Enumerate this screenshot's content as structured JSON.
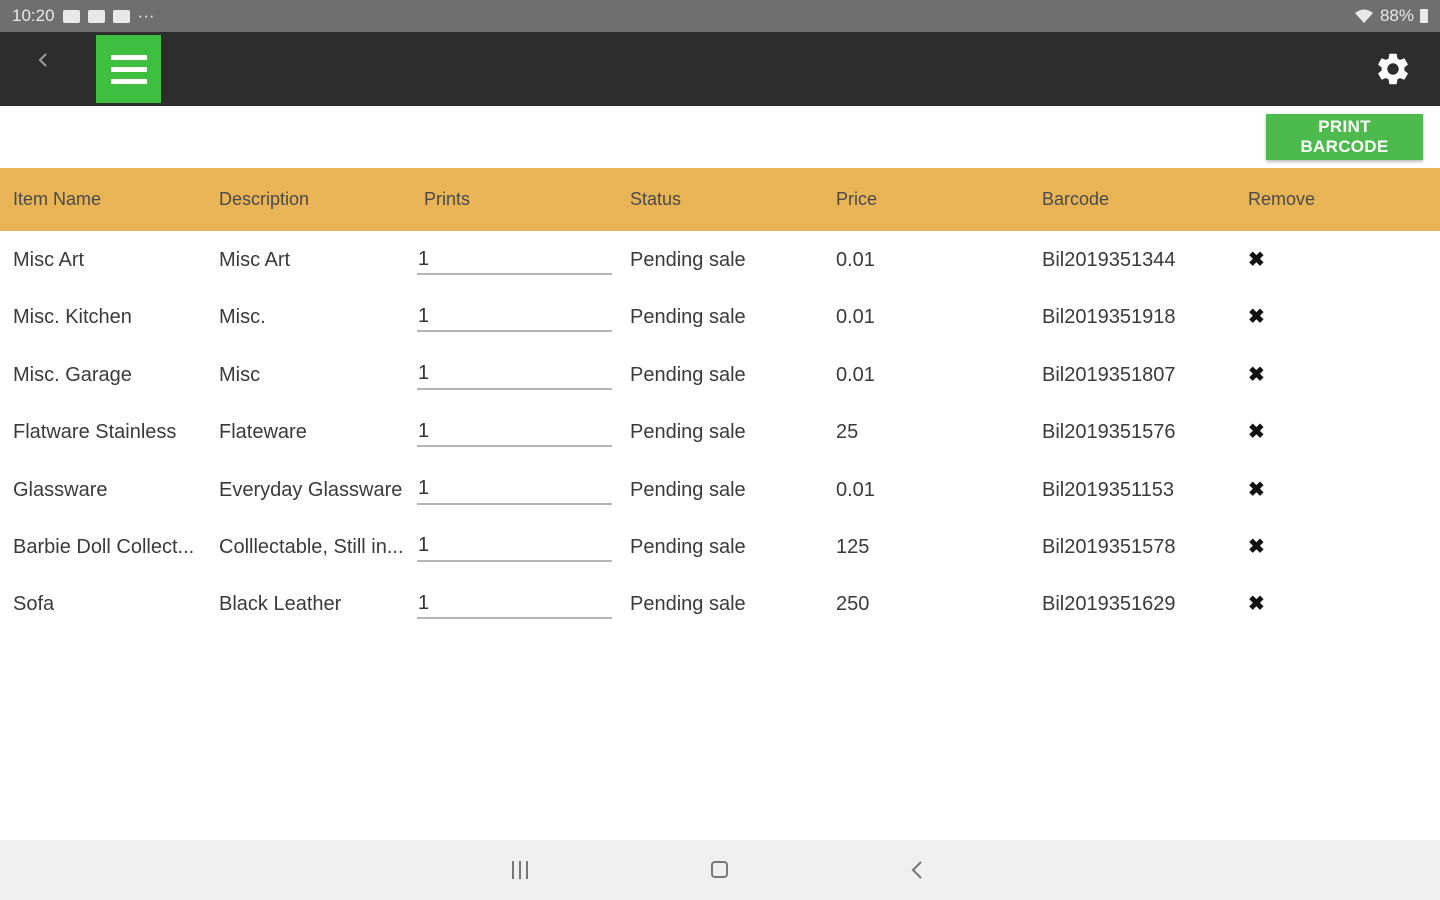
{
  "status_bar": {
    "time": "10:20",
    "more": "···",
    "battery": "88%"
  },
  "app_bar": {
    "back_icon": "chevron-left-icon",
    "menu_icon": "hamburger-menu-icon",
    "settings_icon": "gear-icon",
    "menu_color": "#3fbf3f"
  },
  "toolbar": {
    "print_label": "PRINT BARCODE",
    "print_color": "#4cba4c"
  },
  "table": {
    "header_color": "#e8b456",
    "columns": [
      "Item Name",
      "Description",
      "Prints",
      "Status",
      "Price",
      "Barcode",
      "Remove"
    ],
    "rows": [
      {
        "name": "Misc Art",
        "description": "Misc Art",
        "prints": "1",
        "status": "Pending sale",
        "price": "0.01",
        "barcode": "Bil2019351344",
        "remove": "✖"
      },
      {
        "name": "Misc. Kitchen",
        "description": "Misc.",
        "prints": "1",
        "status": "Pending sale",
        "price": "0.01",
        "barcode": "Bil2019351918",
        "remove": "✖"
      },
      {
        "name": "Misc. Garage",
        "description": "Misc",
        "prints": "1",
        "status": "Pending sale",
        "price": "0.01",
        "barcode": "Bil2019351807",
        "remove": "✖"
      },
      {
        "name": "Flatware Stainless",
        "description": "Flateware",
        "prints": "1",
        "status": "Pending sale",
        "price": "25",
        "barcode": "Bil2019351576",
        "remove": "✖"
      },
      {
        "name": "Glassware",
        "description": "Everyday Glassware",
        "prints": "1",
        "status": "Pending sale",
        "price": "0.01",
        "barcode": "Bil2019351153",
        "remove": "✖"
      },
      {
        "name": "Barbie Doll Collect...",
        "description": "Colllectable, Still in...",
        "prints": "1",
        "status": "Pending sale",
        "price": "125",
        "barcode": "Bil2019351578",
        "remove": "✖"
      },
      {
        "name": "Sofa",
        "description": "Black Leather",
        "prints": "1",
        "status": "Pending sale",
        "price": "250",
        "barcode": "Bil2019351629",
        "remove": "✖"
      }
    ]
  },
  "nav_bar": {
    "recents_icon": "recent-apps-icon",
    "home_icon": "home-icon",
    "back_icon": "back-icon"
  }
}
